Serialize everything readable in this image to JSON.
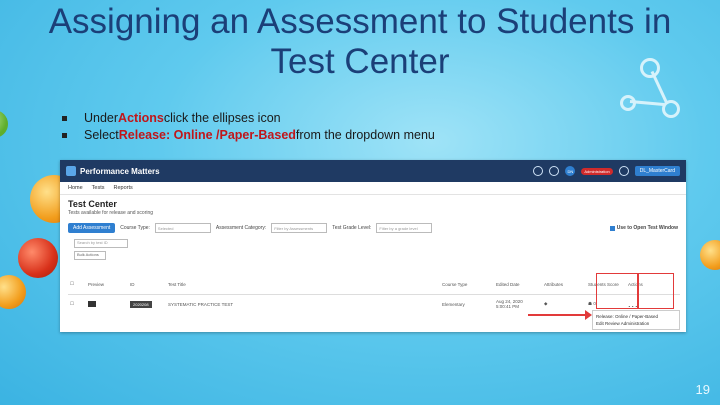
{
  "slide": {
    "title_line1": "Assigning an Assessment to Students in",
    "title_line2": "Test Center",
    "bullet1_pre": "Under ",
    "bullet1_bold": "Actions",
    "bullet1_post": " click the ellipses icon",
    "bullet2_pre": "Select ",
    "bullet2_bold": "Release:  Online /Paper-Based",
    "bullet2_post": " from the dropdown menu",
    "page_number": "19"
  },
  "app": {
    "brand": "Performance Matters",
    "user_badge": "Administration",
    "avatar": "DN",
    "user_menu": "DL_MasterCard",
    "nav": [
      "Home",
      "Tests",
      "Reports"
    ],
    "page_title": "Test Center",
    "page_desc": "Tests available for release and scoring",
    "filters": {
      "button": "Add Assessment",
      "course_type_label": "Course Type:",
      "course_type_value": "Selected",
      "category_label": "Assessment Category:",
      "category_value": "Filter by Assessments",
      "grade_label": "Test Grade Level:",
      "grade_value": "Filter by a grade level",
      "open_new_label": "Use to Open Test Window"
    },
    "search_placeholder": "Search by test ID",
    "bulk_action": "Bulk Actions",
    "columns": [
      "Preview",
      "ID",
      "Test Title",
      "Course Type",
      "Edited Date",
      "Attributes",
      "Students Score",
      "Actions"
    ],
    "row": {
      "id": "2020208",
      "title": "SYSTEMATIC PRACTICE TEST",
      "course_type": "Elementary",
      "edited_date": "Aug 24, 2020",
      "edited_time": "5:00:41 PM",
      "score": "0",
      "actions": "..."
    },
    "dropdown_line1": "Release: Online / Paper-Based",
    "dropdown_line2": "Edit Review Administration"
  },
  "colors": {
    "title": "#1b3f78",
    "highlight": "#c0161a",
    "topbar": "#1f3a63",
    "accent": "#2f7fd0"
  }
}
